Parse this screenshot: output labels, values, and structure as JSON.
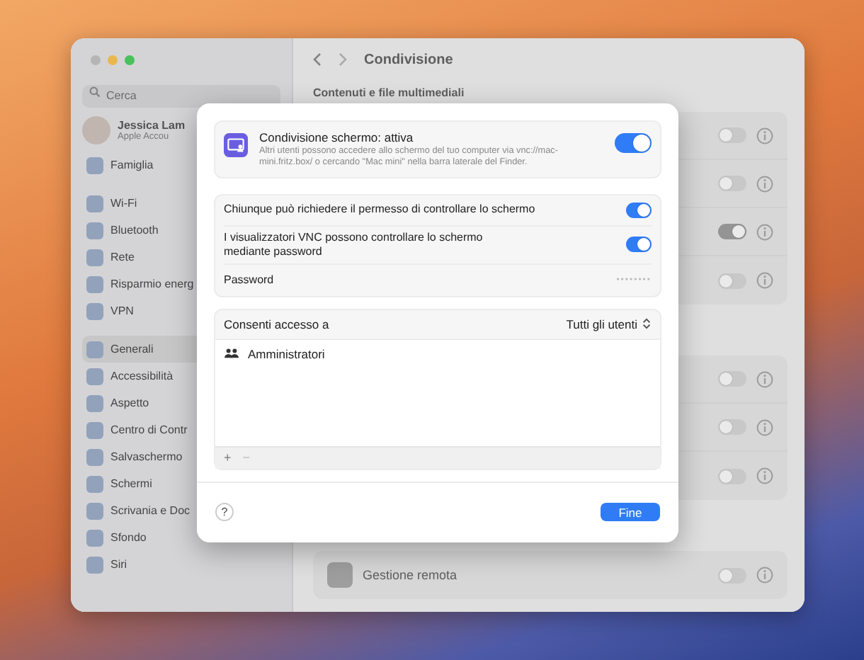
{
  "window": {
    "search": {
      "placeholder": "Cerca"
    },
    "sidebar": {
      "profile": {
        "name": "Jessica Lam",
        "subtitle": "Apple Accou"
      },
      "groups": [
        [
          {
            "label": "Famiglia",
            "selected": false
          }
        ],
        [
          {
            "label": "Wi-Fi",
            "selected": false
          },
          {
            "label": "Bluetooth",
            "selected": false
          },
          {
            "label": "Rete",
            "selected": false
          },
          {
            "label": "Risparmio energ",
            "selected": false
          },
          {
            "label": "VPN",
            "selected": false
          }
        ],
        [
          {
            "label": "Generali",
            "selected": true
          },
          {
            "label": "Accessibilità",
            "selected": false
          },
          {
            "label": "Aspetto",
            "selected": false
          },
          {
            "label": "Centro di Contr",
            "selected": false
          },
          {
            "label": "Salvaschermo",
            "selected": false
          },
          {
            "label": "Schermi",
            "selected": false
          },
          {
            "label": "Scrivania e Doc",
            "selected": false
          },
          {
            "label": "Sfondo",
            "selected": false
          },
          {
            "label": "Siri",
            "selected": false
          }
        ]
      ]
    },
    "title": "Condivisione",
    "section_title": "Contenuti e file multimediali",
    "groups": [
      [
        {
          "on": false
        },
        {
          "on": false
        },
        {
          "on": true
        },
        {
          "on": false
        }
      ],
      [
        {
          "on": false
        },
        {
          "on": false
        },
        {
          "on": false
        }
      ],
      [
        {
          "label": "Gestione remota",
          "on": false
        }
      ]
    ]
  },
  "sheet": {
    "main": {
      "title": "Condivisione schermo: attiva",
      "description": "Altri utenti possono accedere allo schermo del tuo computer via vnc://mac-mini.fritz.box/ o cercando \"Mac mini\" nella barra laterale del Finder.",
      "on": true
    },
    "options": [
      {
        "kind": "toggle",
        "label": "Chiunque può richiedere il permesso di controllare lo schermo",
        "on": true
      },
      {
        "kind": "toggle",
        "label": "I visualizzatori VNC possono controllare lo schermo mediante password",
        "on": true
      },
      {
        "kind": "password",
        "label": "Password",
        "value": "••••••••"
      }
    ],
    "access": {
      "label": "Consenti accesso a",
      "popup": "Tutti gli utenti",
      "items": [
        {
          "label": "Amministratori"
        }
      ],
      "add": "+",
      "remove": "−"
    },
    "help": "?",
    "done": "Fine"
  }
}
